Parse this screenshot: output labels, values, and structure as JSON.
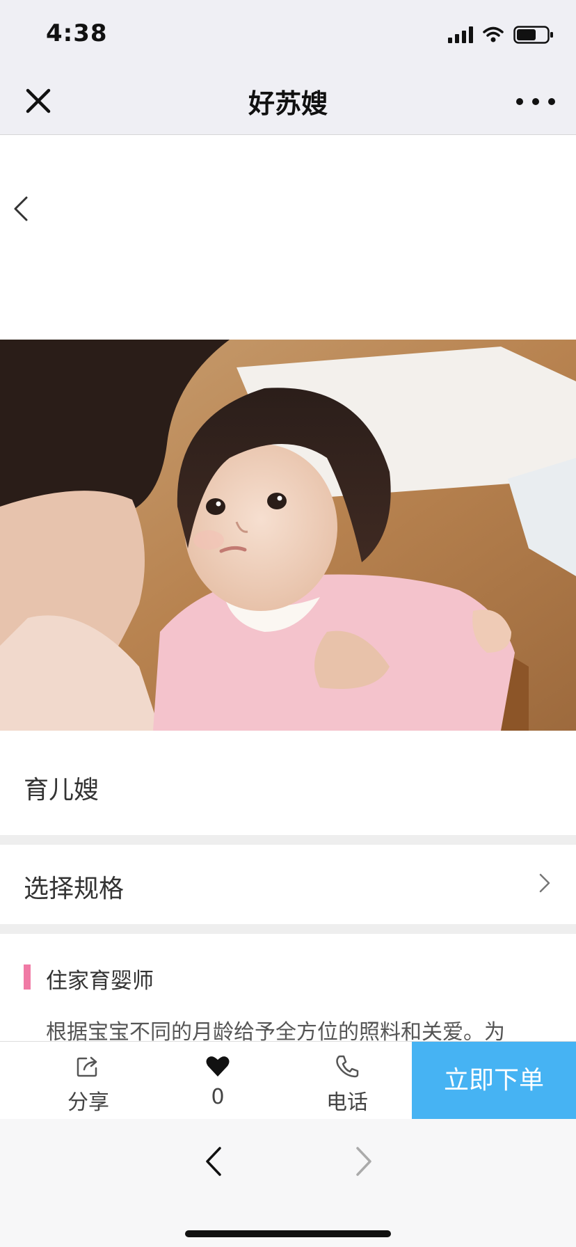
{
  "status_bar": {
    "time": "4:38",
    "icons": [
      "signal-icon",
      "wifi-icon",
      "battery-icon"
    ]
  },
  "nav": {
    "title": "好苏嫂",
    "close_icon": "close-icon",
    "more_icon": "more-icon"
  },
  "product": {
    "title": "育儿嫂",
    "spec_label": "选择规格",
    "section_title": "住家育婴师",
    "description": "根据宝宝不同的月龄给予全方位的照料和关爱。为"
  },
  "actions": {
    "share_label": "分享",
    "like_count": "0",
    "phone_label": "电话",
    "order_label": "立即下单"
  },
  "colors": {
    "accent": "#46b3f3",
    "section_marker": "#f07aa5",
    "nav_background": "#efeff4"
  }
}
